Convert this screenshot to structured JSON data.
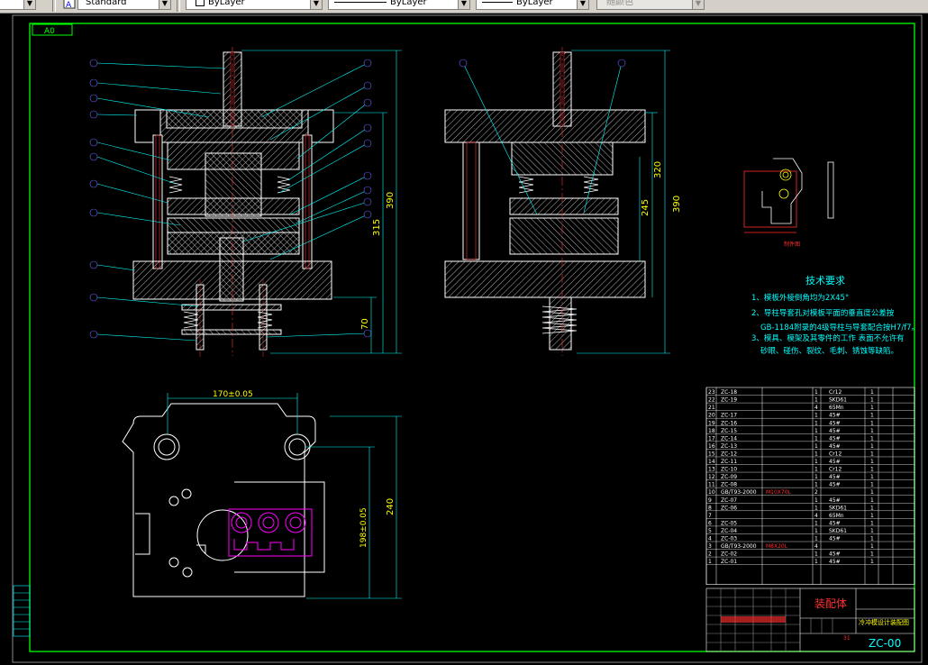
{
  "toolbar": {
    "textstyle": "Standard",
    "layer": "ByLayer",
    "linetype": "ByLayer",
    "lineweight": "ByLayer",
    "plotstyle": "随颜色"
  },
  "drawing": {
    "revision": "A0",
    "dims": {
      "front_390": "390",
      "front_315": "315",
      "front_70": "70",
      "side_245": "245",
      "side_320": "320",
      "side_390": "390",
      "plan_width": "170±0.05",
      "plan_height": "240",
      "plan_inner": "198±0.05"
    },
    "part_label": "制件图",
    "tech_title": "技术要求",
    "tech_lines": [
      "1、模板外棱倒角均为2X45°",
      "2、导柱导套孔对模板平面的垂直度公差按",
      "GB-1184附录的4级导柱与导套配合按H7/f7。",
      "3、模具、模架及其零件的工作 表面不允许有",
      "砂眼、碰伤、裂纹、毛刺、锈蚀等缺陷。"
    ],
    "bom": [
      [
        "23",
        "ZC-18",
        "",
        "1",
        "Cr12",
        "1",
        ""
      ],
      [
        "22",
        "ZC-19",
        "",
        "1",
        "SKD61",
        "1",
        ""
      ],
      [
        "21",
        "",
        "",
        "4",
        "65Mn",
        "1",
        ""
      ],
      [
        "20",
        "ZC-17",
        "",
        "1",
        "45#",
        "1",
        ""
      ],
      [
        "19",
        "ZC-16",
        "",
        "1",
        "45#",
        "1",
        ""
      ],
      [
        "18",
        "ZC-15",
        "",
        "1",
        "45#",
        "1",
        ""
      ],
      [
        "17",
        "ZC-14",
        "",
        "1",
        "45#",
        "1",
        ""
      ],
      [
        "16",
        "ZC-13",
        "",
        "1",
        "45#",
        "1",
        ""
      ],
      [
        "15",
        "ZC-12",
        "",
        "1",
        "Cr12",
        "1",
        ""
      ],
      [
        "14",
        "ZC-11",
        "",
        "1",
        "45#",
        "1",
        ""
      ],
      [
        "13",
        "ZC-10",
        "",
        "1",
        "Cr12",
        "1",
        ""
      ],
      [
        "12",
        "ZC-09",
        "",
        "1",
        "45#",
        "1",
        ""
      ],
      [
        "11",
        "ZC-08",
        "",
        "1",
        "45#",
        "1",
        ""
      ],
      [
        "10",
        "GB/T93-2000",
        "M10X70L",
        "2",
        "",
        "1",
        ""
      ],
      [
        "9",
        "ZC-07",
        "",
        "1",
        "45#",
        "1",
        ""
      ],
      [
        "8",
        "ZC-06",
        "",
        "1",
        "SKD61",
        "1",
        ""
      ],
      [
        "7",
        "",
        "",
        "4",
        "65Mn",
        "1",
        ""
      ],
      [
        "6",
        "ZC-05",
        "",
        "1",
        "45#",
        "1",
        ""
      ],
      [
        "5",
        "ZC-04",
        "",
        "1",
        "SKD61",
        "1",
        ""
      ],
      [
        "4",
        "ZC-03",
        "",
        "1",
        "45#",
        "1",
        ""
      ],
      [
        "3",
        "GB/T93-2000",
        "M8X20L",
        "4",
        "",
        "1",
        ""
      ],
      [
        "2",
        "ZC-02",
        "",
        "1",
        "45#",
        "1",
        ""
      ],
      [
        "1",
        "ZC-01",
        "",
        "1",
        "45#",
        "1",
        ""
      ]
    ],
    "title_block": {
      "assembly": "装配体",
      "name": "冷冲模设计装配图",
      "drawing_no": "ZC-00",
      "sheet": "31"
    },
    "colors": {
      "border": "#00ff00",
      "hatch": "#ffffff",
      "leader": "#00ffff",
      "bubble": "#6666ff",
      "part": "#ff00ff",
      "red": "#ff3030",
      "yellow": "#ffff00"
    }
  }
}
